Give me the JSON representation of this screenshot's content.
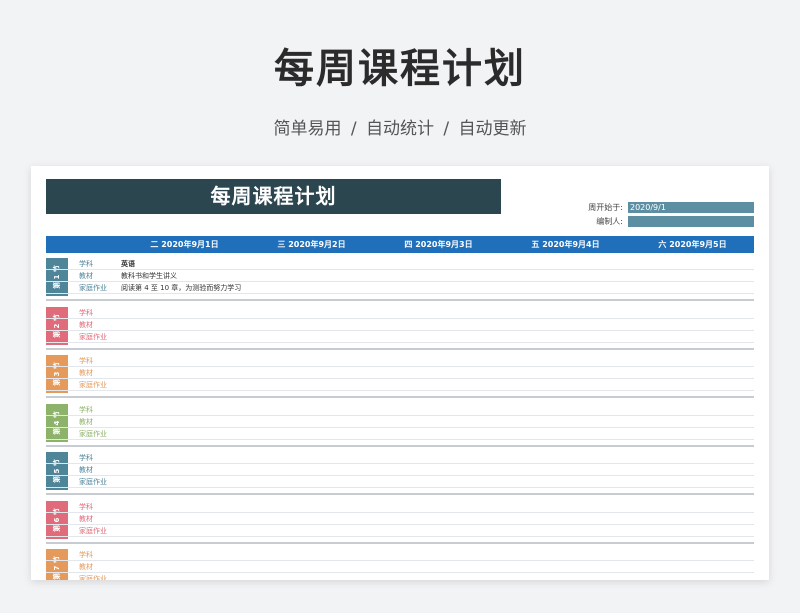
{
  "promo": {
    "title": "每周课程计划",
    "subtitle": "简单易用  /  自动统计  /  自动更新"
  },
  "sheet": {
    "title": "每周课程计划",
    "week_start_label": "周开始于:",
    "week_start_value": "2020/9/1",
    "editor_label": "编制人:",
    "editor_value": ""
  },
  "days": [
    "二 2020年9月1日",
    "三 2020年9月2日",
    "四 2020年9月3日",
    "五 2020年9月4日",
    "六 2020年9月5日"
  ],
  "row_labels": [
    "学科",
    "教材",
    "家庭作业"
  ],
  "periods": [
    {
      "label": "第 1 节",
      "color": "#4e8599",
      "label_color": "#4e8599",
      "subject": "英语",
      "material": "教科书和学生讲义",
      "homework": "阅读第 4 至 10 章，为测验而努力学习"
    },
    {
      "label": "第 2 节",
      "color": "#df6b7b",
      "label_color": "#df6b7b",
      "subject": "",
      "material": "",
      "homework": ""
    },
    {
      "label": "第 3 节",
      "color": "#e59a5c",
      "label_color": "#e59a5c",
      "subject": "",
      "material": "",
      "homework": ""
    },
    {
      "label": "第 4 节",
      "color": "#8db36a",
      "label_color": "#8db36a",
      "subject": "",
      "material": "",
      "homework": ""
    },
    {
      "label": "第 5 节",
      "color": "#4e8599",
      "label_color": "#4e8599",
      "subject": "",
      "material": "",
      "homework": ""
    },
    {
      "label": "第 6 节",
      "color": "#df6b7b",
      "label_color": "#df6b7b",
      "subject": "",
      "material": "",
      "homework": ""
    },
    {
      "label": "第 7 节",
      "color": "#e59a5c",
      "label_color": "#e59a5c",
      "subject": "",
      "material": "",
      "homework": ""
    }
  ]
}
